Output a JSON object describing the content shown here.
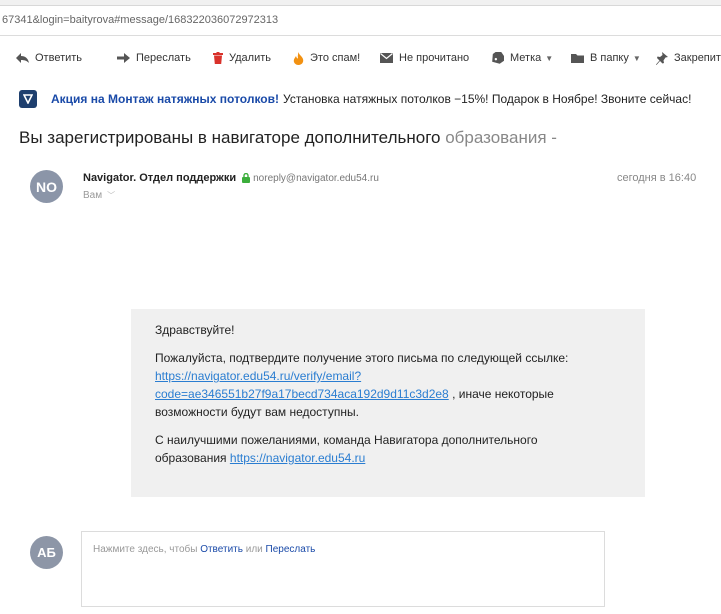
{
  "browser": {
    "url": "67341&login=baityrova#message/168322036072972313"
  },
  "toolbar": {
    "reply": "Ответить",
    "forward": "Переслать",
    "delete": "Удалить",
    "spam": "Это спам!",
    "unread": "Не прочитано",
    "label": "Метка",
    "folder": "В папку",
    "pin": "Закрепить"
  },
  "ad": {
    "link": "Акция на Монтаж натяжных потолков!",
    "text": "Установка натяжных потолков −15%! Подарок в Ноябре! Звоните сейчас!"
  },
  "message": {
    "subject": "Вы зарегистрированы в навигаторе дополнительного",
    "subject_fade": " образования -",
    "sender_initials": "NO",
    "sender_name": "Navigator. Отдел поддержки",
    "sender_email": "noreply@navigator.edu54.ru",
    "recipient": "Вам",
    "date": "сегодня в 16:40",
    "body": {
      "greeting": "Здравствуйте!",
      "confirm_text": "Пожалуйста, подтвердите получение этого письма по следующей ссылке:",
      "verify_link_line1": "https://navigator.edu54.ru/verify/email?",
      "verify_link_line2": "code=ae346551b27f9a17becd734aca192d9d11c3d2e8",
      "after_link": " , иначе некоторые",
      "after_link_line2": "возможности будут вам недоступны.",
      "regards": "С наилучшими пожеланиями, команда Навигатора дополнительного",
      "regards_line2": "образования ",
      "site_link": "https://navigator.edu54.ru"
    }
  },
  "reply_area": {
    "user_initials": "АБ",
    "prompt": "Нажмите здесь, чтобы ",
    "reply_link": "Ответить",
    "or_text": " или ",
    "forward_link": "Переслать"
  },
  "colors": {
    "link": "#2a7dd1",
    "ad_link": "#1a4aa8",
    "delete_icon": "#d9322b",
    "spam_icon": "#f29111",
    "secure_lock": "#3cae3c"
  }
}
